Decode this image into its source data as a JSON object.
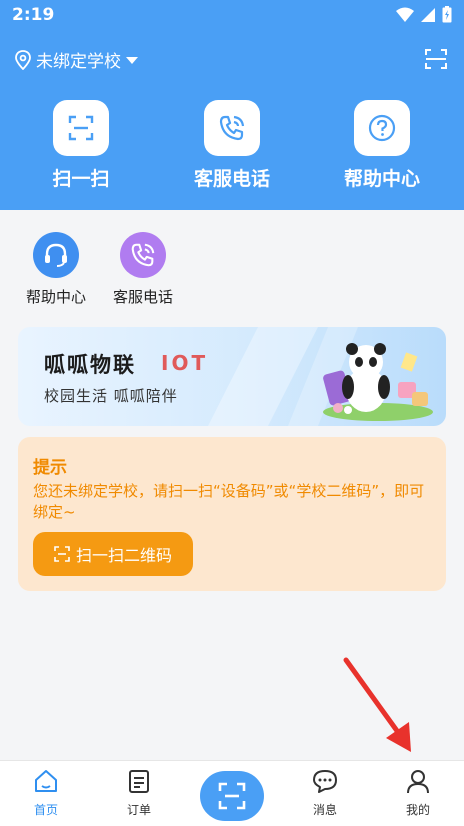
{
  "status": {
    "time": "2:19"
  },
  "header": {
    "school": "未绑定学校",
    "quick_actions": [
      {
        "label": "扫一扫",
        "icon": "scan-icon"
      },
      {
        "label": "客服电话",
        "icon": "phone-icon"
      },
      {
        "label": "帮助中心",
        "icon": "help-icon"
      }
    ]
  },
  "shortcuts": [
    {
      "label": "帮助中心",
      "icon": "headset-icon",
      "color": "#3f8ff0"
    },
    {
      "label": "客服电话",
      "icon": "phone-icon",
      "color": "#b07cf0"
    }
  ],
  "banner": {
    "title": "呱呱物联",
    "tag": "IOT",
    "subtitle": "校园生活 呱呱陪伴"
  },
  "tip": {
    "title": "提示",
    "text": "您还未绑定学校，请扫一扫“设备码”或“学校二维码”，即可绑定~",
    "button": "扫一扫二维码"
  },
  "tabbar": {
    "items": [
      {
        "label": "首页",
        "icon": "home-icon",
        "active": true
      },
      {
        "label": "订单",
        "icon": "order-icon",
        "active": false
      },
      {
        "label": "",
        "icon": "scan-icon",
        "active": false
      },
      {
        "label": "消息",
        "icon": "message-icon",
        "active": false
      },
      {
        "label": "我的",
        "icon": "user-icon",
        "active": false
      }
    ]
  },
  "colors": {
    "primary": "#4a9ff5",
    "accent": "#f59a12",
    "annotation": "#e8322c"
  }
}
